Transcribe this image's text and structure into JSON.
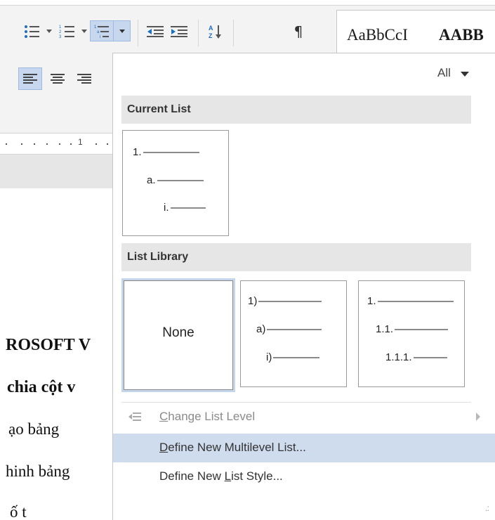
{
  "ribbon": {
    "styles_preview": [
      "AaBbCcI",
      "AABB"
    ],
    "icons": [
      "bullets-icon",
      "numbering-icon",
      "multilevel-list-icon",
      "decrease-indent-icon",
      "increase-indent-icon",
      "sort-icon",
      "show-formatting-icon",
      "align-left-icon",
      "center-icon",
      "align-right-icon"
    ]
  },
  "ruler": {
    "mark": "1"
  },
  "document": {
    "lines": [
      "ROSOFT V",
      "chia cột v",
      "ạo bảng",
      "hinh bảng",
      "ố t"
    ]
  },
  "menu": {
    "filter_label": "All",
    "current_list": {
      "header": "Current List",
      "levels": [
        "1.",
        "a.",
        "i."
      ]
    },
    "list_library": {
      "header": "List Library",
      "tiles": [
        {
          "label": "None"
        },
        {
          "levels": [
            "1)",
            "a)",
            "i)"
          ]
        },
        {
          "levels": [
            "1.",
            "1.1.",
            "1.1.1."
          ]
        }
      ]
    },
    "items": [
      {
        "pre": "",
        "accel": "C",
        "post": "hange List Level",
        "enabled": false,
        "submenu": true
      },
      {
        "pre": "",
        "accel": "D",
        "post": "efine New Multilevel List...",
        "enabled": true,
        "highlighted": true
      },
      {
        "pre": "Define New ",
        "accel": "L",
        "post": "ist Style...",
        "enabled": true
      }
    ]
  },
  "colors": {
    "highlight": "#cfdcee",
    "header_bg": "#e6e6e6",
    "accent": "#1e6fbf"
  }
}
